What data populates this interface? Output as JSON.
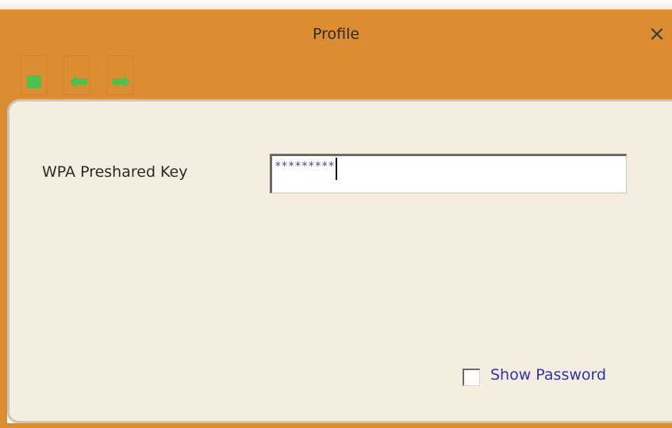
{
  "window": {
    "title": "Profile",
    "close_glyph": "×",
    "toolbar": [
      {
        "name": "stop",
        "icon": "green-square-icon"
      },
      {
        "name": "back",
        "icon": "green-left-arrow-icon"
      },
      {
        "name": "forward",
        "icon": "green-right-arrow-icon"
      }
    ]
  },
  "form": {
    "psk_label": "WPA Preshared Key",
    "psk_value": "*********",
    "show_password_label": "Show Password",
    "show_password_checked": false
  },
  "colors": {
    "titlebar": "#dc8c31",
    "panel": "#f6ede1",
    "toolbar_icon": "#4cc24c",
    "link_text": "#2d35a8"
  }
}
